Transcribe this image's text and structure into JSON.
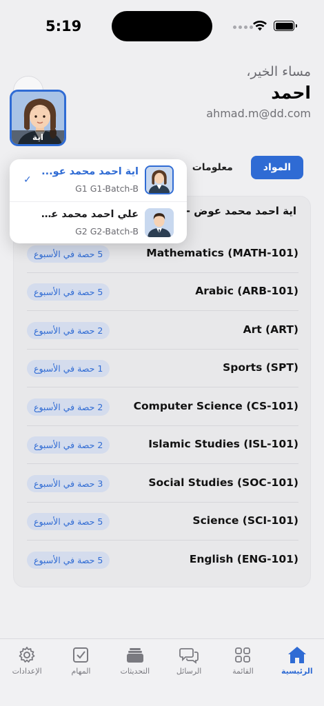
{
  "status_bar": {
    "time": "5:19"
  },
  "header": {
    "greeting": "مساء الخير،",
    "user_name": "احمد",
    "email": "ahmad.m@dd.com",
    "profile_label": "اية"
  },
  "tabs": [
    {
      "label": "المواد",
      "active": true
    },
    {
      "label": "معلومات",
      "active": false
    }
  ],
  "dropdown": {
    "items": [
      {
        "name": "اية احمد محمد عوض",
        "display": "اية احمد محمد عو...",
        "class": "G1 G1-Batch-B",
        "selected": true,
        "avatar": "girl-avatar"
      },
      {
        "name": "علي احمد محمد عوض",
        "display": "علي احمد محمد عوض",
        "class": "G2 G2-Batch-B",
        "selected": false,
        "avatar": "boy-avatar"
      }
    ]
  },
  "subjects_card": {
    "title": "اية احمد محمد عوض -",
    "subjects": [
      {
        "name": "Mathematics (MATH-101)",
        "periods": "5 حصة في الأسبوع"
      },
      {
        "name": "Arabic (ARB-101)",
        "periods": "5 حصة في الأسبوع"
      },
      {
        "name": "Art (ART)",
        "periods": "2 حصة في الأسبوع"
      },
      {
        "name": "Sports (SPT)",
        "periods": "1 حصة في الأسبوع"
      },
      {
        "name": "Computer Science (CS-101)",
        "periods": "2 حصة في الأسبوع"
      },
      {
        "name": "Islamic Studies (ISL-101)",
        "periods": "2 حصة في الأسبوع"
      },
      {
        "name": "Social Studies (SOC-101)",
        "periods": "3 حصة في الأسبوع"
      },
      {
        "name": "Science (SCI-101)",
        "periods": "5 حصة في الأسبوع"
      },
      {
        "name": "English (ENG-101)",
        "periods": "5 حصة في الأسبوع"
      }
    ]
  },
  "bottom_nav": [
    {
      "label": "الإعدادات",
      "icon": "gear-icon",
      "active": false
    },
    {
      "label": "المهام",
      "icon": "checkbox-icon",
      "active": false
    },
    {
      "label": "التحديثات",
      "icon": "stack-icon",
      "active": false
    },
    {
      "label": "الرسائل",
      "icon": "chat-icon",
      "active": false
    },
    {
      "label": "القائمة",
      "icon": "grid-icon",
      "active": false
    },
    {
      "label": "الرئيسية",
      "icon": "home-icon",
      "active": true
    }
  ],
  "colors": {
    "accent": "#2f6bd4",
    "pill_bg": "#d4dced",
    "background": "#efeff1"
  }
}
